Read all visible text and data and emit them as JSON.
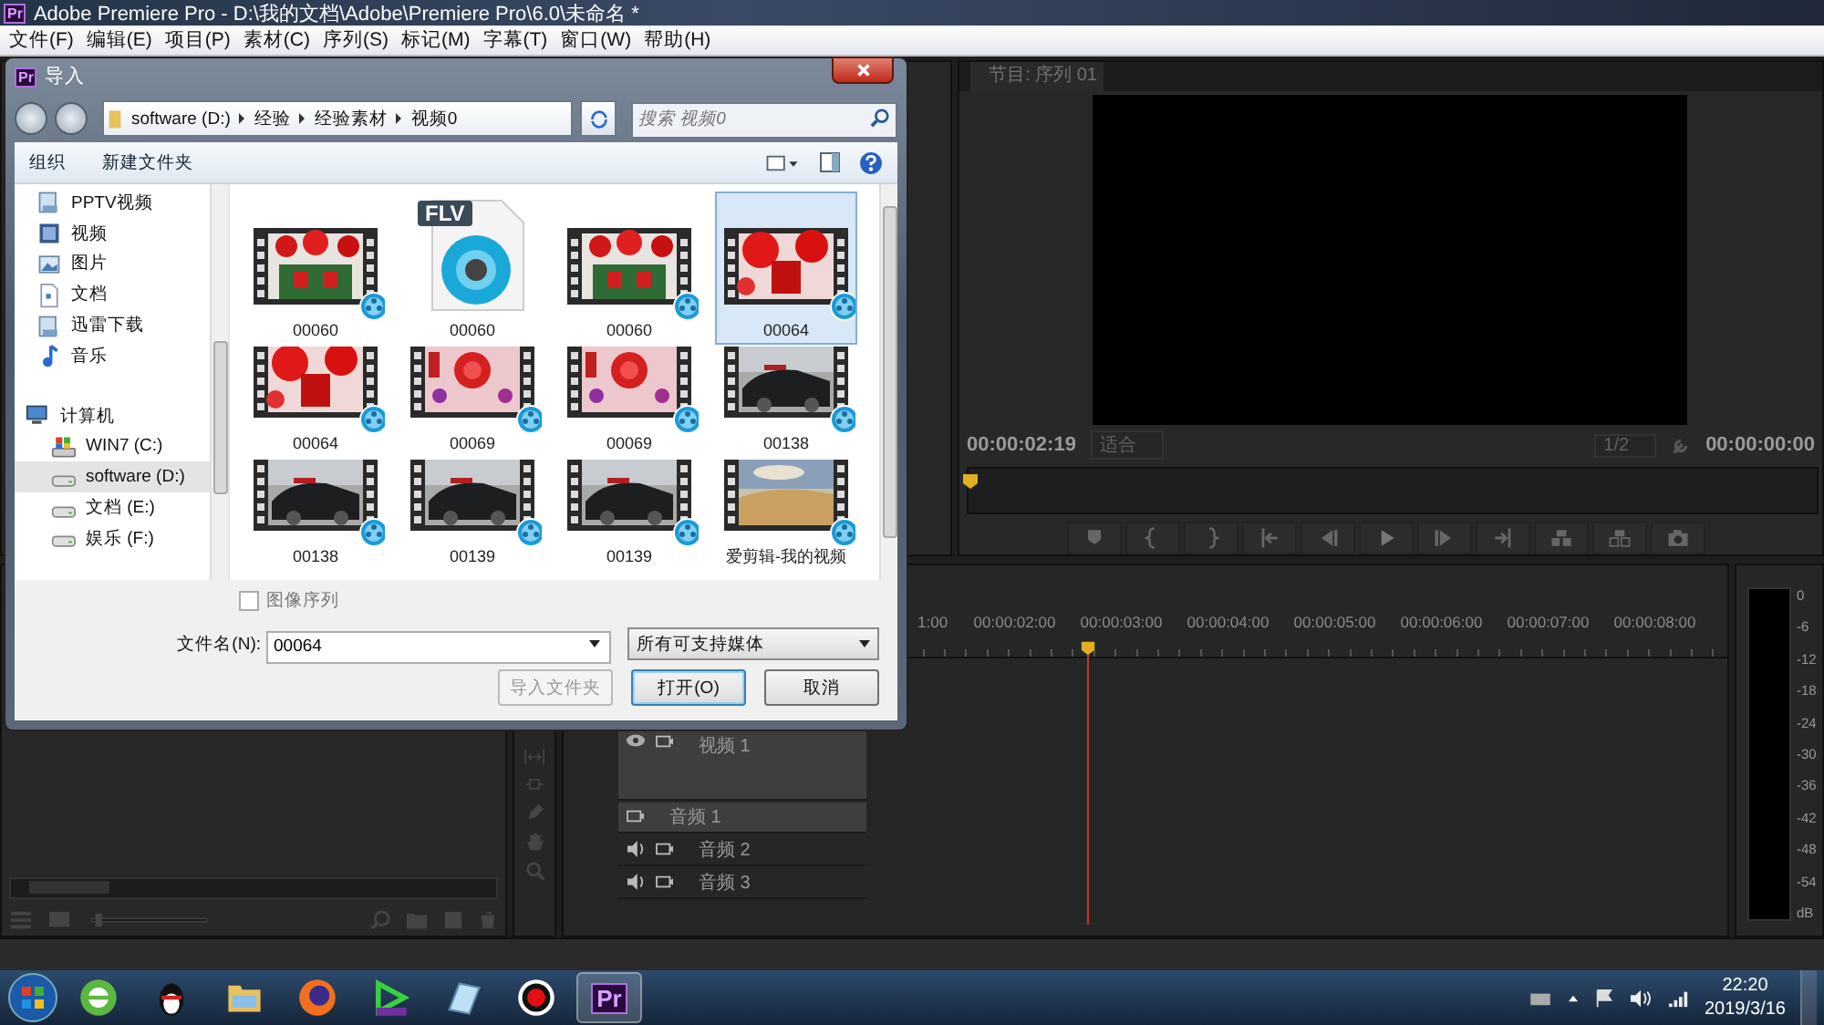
{
  "app_window": {
    "icon_text": "Pr",
    "title": "Adobe Premiere Pro - D:\\我的文档\\Adobe\\Premiere Pro\\6.0\\未命名 *"
  },
  "menu": [
    "文件(F)",
    "编辑(E)",
    "项目(P)",
    "素材(C)",
    "序列(S)",
    "标记(M)",
    "字幕(T)",
    "窗口(W)",
    "帮助(H)"
  ],
  "program_monitor": {
    "tab": "节目: 序列 01",
    "timecode_current": "00:00:02:19",
    "fit": "适合",
    "resolution": "1/2",
    "timecode_duration": "00:00:00:00"
  },
  "timeline": {
    "ruler": [
      "1:00",
      "00:00:02:00",
      "00:00:03:00",
      "00:00:04:00",
      "00:00:05:00",
      "00:00:06:00",
      "00:00:07:00",
      "00:00:08:00"
    ],
    "tracks": [
      {
        "name": "视频 1",
        "kind": "video",
        "selected": true
      },
      {
        "name": "音频 1",
        "kind": "audio",
        "selected": true
      },
      {
        "name": "音频 2",
        "kind": "audio",
        "selected": false
      },
      {
        "name": "音频 3",
        "kind": "audio",
        "selected": false
      }
    ]
  },
  "meter": {
    "scale": [
      "0",
      "-6",
      "-12",
      "-18",
      "-24",
      "-30",
      "-36",
      "-42",
      "-48",
      "-54",
      "dB"
    ]
  },
  "dialog": {
    "icon_text": "Pr",
    "title": "导入",
    "breadcrumb": [
      "software (D:)",
      "经验",
      "经验素材",
      "视频0"
    ],
    "search": {
      "placeholder": "搜索 视频0"
    },
    "toolbar": [
      "组织",
      "新建文件夹"
    ],
    "nav": [
      {
        "label": "PPTV视频",
        "kind": "library",
        "selected": false
      },
      {
        "label": "视频",
        "kind": "video",
        "selected": false
      },
      {
        "label": "图片",
        "kind": "picture",
        "selected": false
      },
      {
        "label": "文档",
        "kind": "document",
        "selected": false
      },
      {
        "label": "迅雷下载",
        "kind": "library",
        "selected": false
      },
      {
        "label": "音乐",
        "kind": "music",
        "selected": false
      },
      {
        "label": "计算机",
        "kind": "computer",
        "selected": false,
        "children": [
          {
            "label": "WIN7 (C:)",
            "kind": "system-drive",
            "selected": false
          },
          {
            "label": "software (D:)",
            "kind": "drive",
            "selected": true
          },
          {
            "label": "文档 (E:)",
            "kind": "drive",
            "selected": false
          },
          {
            "label": "娱乐 (F:)",
            "kind": "drive",
            "selected": false
          }
        ]
      }
    ],
    "files": [
      {
        "name": "00060",
        "kind": "video",
        "selected": false
      },
      {
        "name": "00060",
        "kind": "flv",
        "badge": "FLV",
        "selected": false
      },
      {
        "name": "00060",
        "kind": "video",
        "selected": false
      },
      {
        "name": "00064",
        "kind": "video",
        "selected": true
      },
      {
        "name": "00064",
        "kind": "video",
        "selected": false
      },
      {
        "name": "00069",
        "kind": "video",
        "selected": false
      },
      {
        "name": "00069",
        "kind": "video",
        "selected": false
      },
      {
        "name": "00138",
        "kind": "video",
        "selected": false
      },
      {
        "name": "00138",
        "kind": "video",
        "selected": false
      },
      {
        "name": "00139",
        "kind": "video",
        "selected": false
      },
      {
        "name": "00139",
        "kind": "video",
        "selected": false
      },
      {
        "name": "爱剪辑-我的视频",
        "kind": "video",
        "selected": false
      }
    ],
    "image_sequence": {
      "label": "图像序列",
      "checked": false,
      "disabled": true
    },
    "filename": {
      "label": "文件名(N):",
      "value": "00064"
    },
    "filetype": "所有可支持媒体",
    "buttons": [
      {
        "label": "导入文件夹",
        "disabled": true,
        "default": false
      },
      {
        "label": "打开(O)",
        "disabled": false,
        "default": true
      },
      {
        "label": "取消",
        "disabled": false,
        "default": false
      }
    ]
  },
  "taskbar": {
    "apps": [
      {
        "kind": "browser-e"
      },
      {
        "kind": "penguin"
      },
      {
        "kind": "folder"
      },
      {
        "kind": "firefox"
      },
      {
        "kind": "play"
      },
      {
        "kind": "notepad"
      },
      {
        "kind": "record"
      },
      {
        "kind": "premiere",
        "label": "Pr",
        "selected": true
      }
    ],
    "clock_time": "22:20",
    "clock_date": "2019/3/16"
  }
}
